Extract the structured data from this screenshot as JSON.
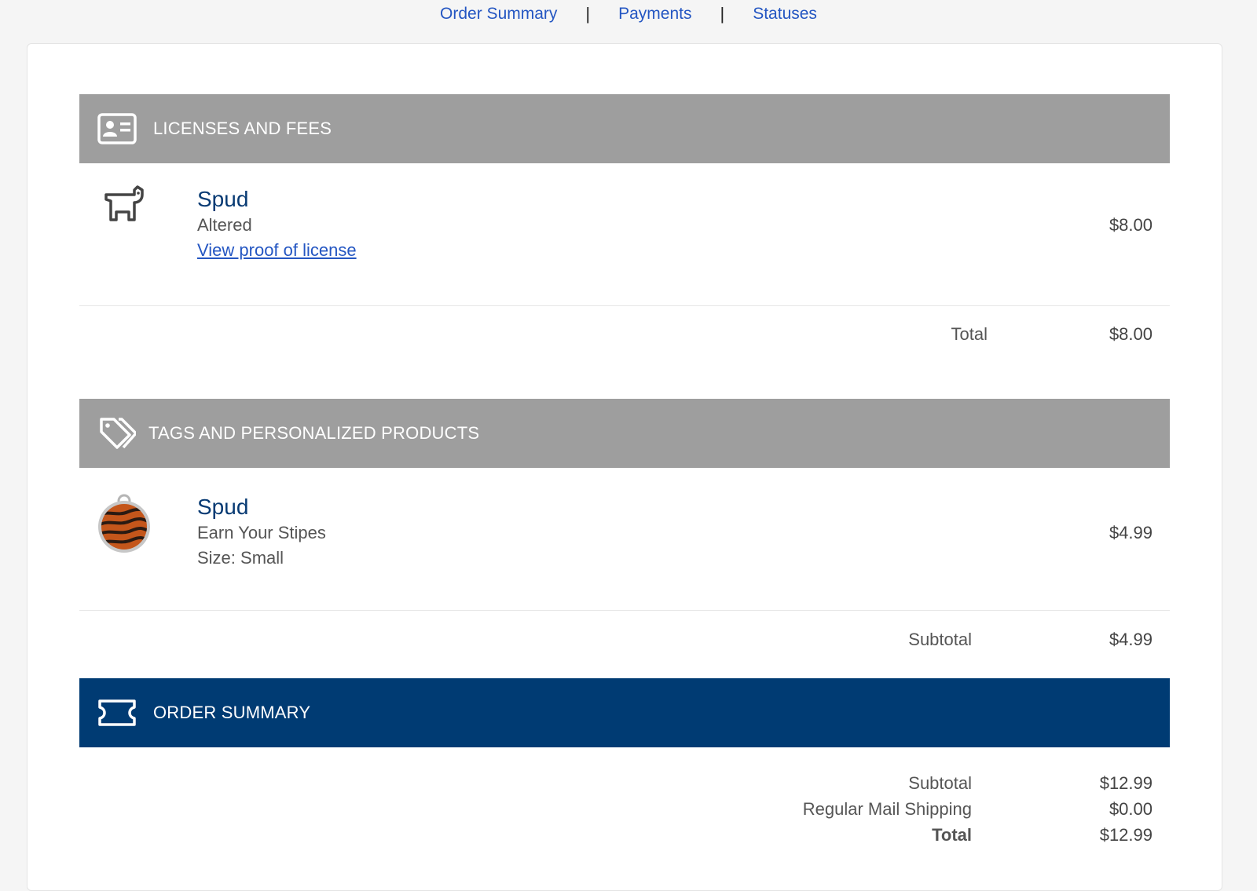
{
  "nav": {
    "order_summary": "Order Summary",
    "payments": "Payments",
    "statuses": "Statuses",
    "separator": "|"
  },
  "licenses": {
    "header": "LICENSES AND FEES",
    "icon": "id-card-icon",
    "item": {
      "name": "Spud",
      "status": "Altered",
      "link": "View proof of license",
      "price": "$8.00",
      "icon": "dog-icon"
    },
    "total_label": "Total",
    "total_value": "$8.00"
  },
  "tags": {
    "header": "TAGS AND PERSONALIZED PRODUCTS",
    "icon": "tags-icon",
    "item": {
      "name": "Spud",
      "design": "Earn Your Stipes",
      "size": "Size: Small",
      "price": "$4.99",
      "icon": "pet-tag-image"
    },
    "subtotal_label": "Subtotal",
    "subtotal_value": "$4.99"
  },
  "summary": {
    "header": "ORDER SUMMARY",
    "icon": "ticket-icon",
    "subtotal_label": "Subtotal",
    "subtotal_value": "$12.99",
    "shipping_label": "Regular Mail Shipping",
    "shipping_value": "$0.00",
    "total_label": "Total",
    "total_value": "$12.99"
  },
  "colors": {
    "section_gray": "#9e9e9e",
    "section_navy": "#003b73",
    "link_blue": "#2456c2",
    "name_navy": "#073a73"
  }
}
